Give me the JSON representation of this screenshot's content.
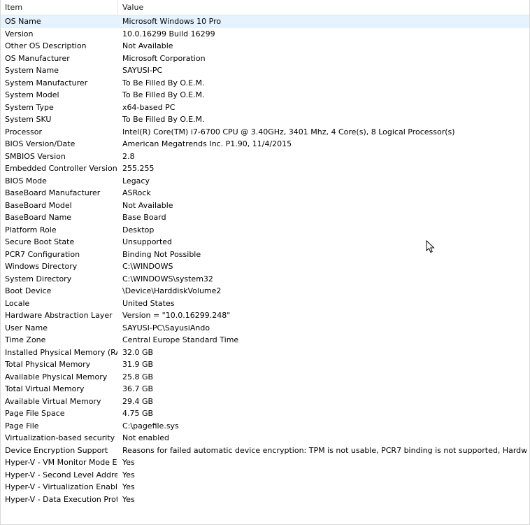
{
  "columns": {
    "item": "Item",
    "value": "Value"
  },
  "rows": [
    {
      "item": "OS Name",
      "value": "Microsoft Windows 10 Pro"
    },
    {
      "item": "Version",
      "value": "10.0.16299 Build 16299"
    },
    {
      "item": "Other OS Description",
      "value": "Not Available"
    },
    {
      "item": "OS Manufacturer",
      "value": "Microsoft Corporation"
    },
    {
      "item": "System Name",
      "value": "SAYUSI-PC"
    },
    {
      "item": "System Manufacturer",
      "value": "To Be Filled By O.E.M."
    },
    {
      "item": "System Model",
      "value": "To Be Filled By O.E.M."
    },
    {
      "item": "System Type",
      "value": "x64-based PC"
    },
    {
      "item": "System SKU",
      "value": "To Be Filled By O.E.M."
    },
    {
      "item": "Processor",
      "value": "Intel(R) Core(TM) i7-6700 CPU @ 3.40GHz, 3401 Mhz, 4 Core(s), 8 Logical Processor(s)"
    },
    {
      "item": "BIOS Version/Date",
      "value": "American Megatrends Inc. P1.90, 11/4/2015"
    },
    {
      "item": "SMBIOS Version",
      "value": "2.8"
    },
    {
      "item": "Embedded Controller Version",
      "value": "255.255"
    },
    {
      "item": "BIOS Mode",
      "value": "Legacy"
    },
    {
      "item": "BaseBoard Manufacturer",
      "value": "ASRock"
    },
    {
      "item": "BaseBoard Model",
      "value": "Not Available"
    },
    {
      "item": "BaseBoard Name",
      "value": "Base Board"
    },
    {
      "item": "Platform Role",
      "value": "Desktop"
    },
    {
      "item": "Secure Boot State",
      "value": "Unsupported"
    },
    {
      "item": "PCR7 Configuration",
      "value": "Binding Not Possible"
    },
    {
      "item": "Windows Directory",
      "value": "C:\\WINDOWS"
    },
    {
      "item": "System Directory",
      "value": "C:\\WINDOWS\\system32"
    },
    {
      "item": "Boot Device",
      "value": "\\Device\\HarddiskVolume2"
    },
    {
      "item": "Locale",
      "value": "United States"
    },
    {
      "item": "Hardware Abstraction Layer",
      "value": "Version = \"10.0.16299.248\""
    },
    {
      "item": "User Name",
      "value": "SAYUSI-PC\\SayusiAndo"
    },
    {
      "item": "Time Zone",
      "value": "Central Europe Standard Time"
    },
    {
      "item": "Installed Physical Memory (RAM)",
      "value": "32.0 GB"
    },
    {
      "item": "Total Physical Memory",
      "value": "31.9 GB"
    },
    {
      "item": "Available Physical Memory",
      "value": "25.8 GB"
    },
    {
      "item": "Total Virtual Memory",
      "value": "36.7 GB"
    },
    {
      "item": "Available Virtual Memory",
      "value": "29.4 GB"
    },
    {
      "item": "Page File Space",
      "value": "4.75 GB"
    },
    {
      "item": "Page File",
      "value": "C:\\pagefile.sys"
    },
    {
      "item": "Virtualization-based security",
      "value": "Not enabled"
    },
    {
      "item": "Device Encryption Support",
      "value": "Reasons for failed automatic device encryption: TPM is not usable, PCR7 binding is not supported, Hardware Security ..."
    },
    {
      "item": "Hyper-V - VM Monitor Mode E...",
      "value": "Yes"
    },
    {
      "item": "Hyper-V - Second Level Addres...",
      "value": "Yes"
    },
    {
      "item": "Hyper-V - Virtualization Enable...",
      "value": "Yes"
    },
    {
      "item": "Hyper-V - Data Execution Prote...",
      "value": "Yes"
    }
  ],
  "selected_row": "OS Name",
  "colors": {
    "selection": "#e5f3ff",
    "header_border": "#e5e5e5"
  },
  "icons": {
    "cursor": "mouse-pointer-icon"
  }
}
